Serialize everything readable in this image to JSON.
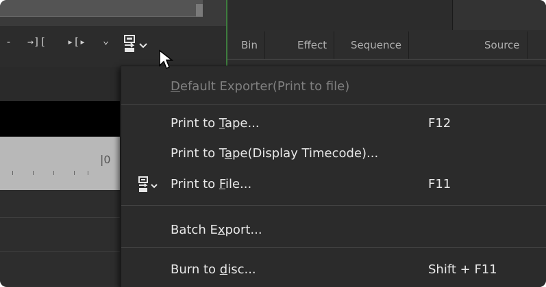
{
  "toolbar": {
    "tools": [
      "-",
      "→][",
      "▸[▸",
      "⌄"
    ]
  },
  "bin_panel": {
    "tabs": [
      "Bin",
      "Effect",
      "Sequence marker",
      "Source"
    ]
  },
  "menu": {
    "items": [
      {
        "label_pre": "",
        "label_u": "D",
        "label_post": "efault Exporter(Print to file)",
        "shortcut": "",
        "disabled": true
      },
      {
        "label_pre": "Print to ",
        "label_u": "T",
        "label_post": "ape...",
        "shortcut": "F12",
        "disabled": false
      },
      {
        "label_pre": "Print to T",
        "label_u": "a",
        "label_post": "pe(Display Timecode)...",
        "shortcut": "",
        "disabled": false
      },
      {
        "label_pre": "Print to ",
        "label_u": "F",
        "label_post": "ile...",
        "shortcut": "F11",
        "disabled": false,
        "icon": "export-icon"
      },
      {
        "label_pre": "Batch E",
        "label_u": "x",
        "label_post": "port...",
        "shortcut": "",
        "disabled": false
      },
      {
        "label_pre": "Burn to ",
        "label_u": "d",
        "label_post": "isc...",
        "shortcut": "Shift + F11",
        "disabled": false
      }
    ]
  },
  "ruler": {
    "marker_label": "|0"
  },
  "colors": {
    "accent_green": "#3e7d3e",
    "menu_bg": "#2b2b2b",
    "text": "#e8e8e8",
    "disabled_text": "#808080"
  }
}
